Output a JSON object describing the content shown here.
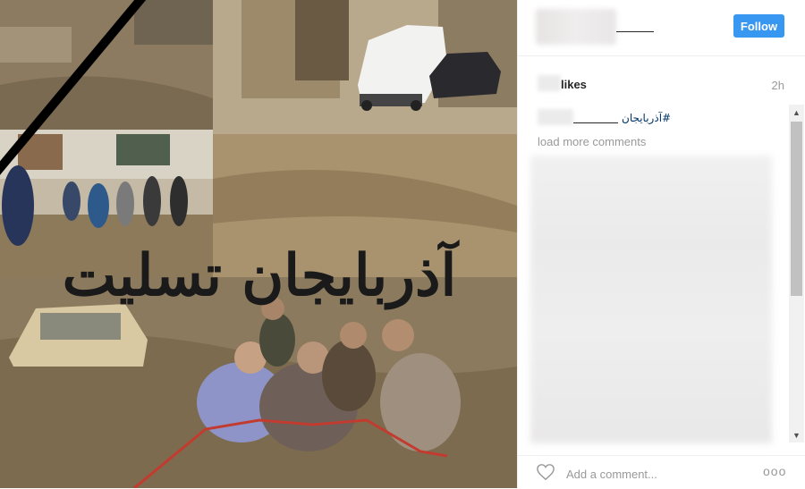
{
  "post": {
    "image_caption": "آذربایجان تسلیت"
  },
  "header": {
    "follow_label": "Follow"
  },
  "stats": {
    "likes_label": "likes",
    "time_label": "2h"
  },
  "caption": {
    "hashtag": "آذربایجان#"
  },
  "comments": {
    "load_more_label": "load more comments"
  },
  "comment_bar": {
    "placeholder": "Add a comment...",
    "more_label": "ooo"
  },
  "icons": {
    "like": "heart-outline-icon",
    "more": "more-options-icon",
    "scroll_up": "chevron-up-icon",
    "scroll_down": "chevron-down-icon"
  },
  "colors": {
    "follow_button": "#3897f0",
    "hashtag": "#003569",
    "muted_text": "#999999",
    "mourning_ribbon": "#000000"
  }
}
